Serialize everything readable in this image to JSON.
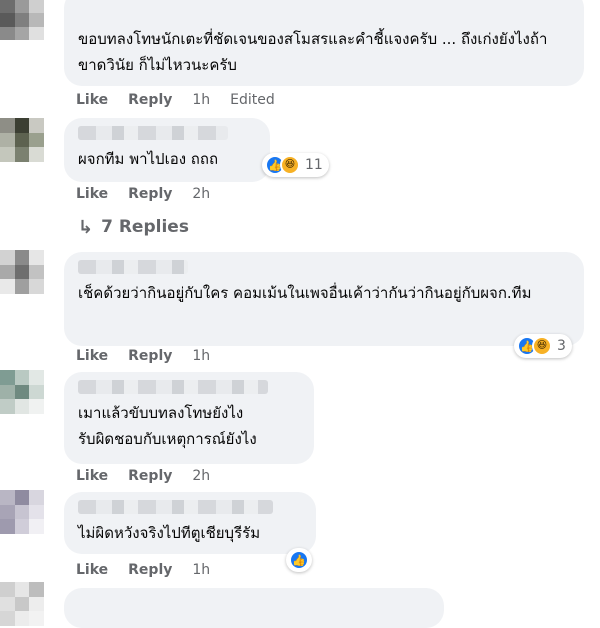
{
  "comments": [
    {
      "text": "ขอบทลงโทษนักเตะที่ชัดเจนของสโมสรและคำชี้แจงครับ ... ถึงเก่งยังไงถ้าขาดวินัย ก็ไม่ไหวนะครับ",
      "like": "Like",
      "reply": "Reply",
      "time": "1h",
      "edited": "Edited"
    },
    {
      "text": "ผจกทีม พาไปเอง ถถถ",
      "like": "Like",
      "reply": "Reply",
      "time": "2h",
      "reactions": {
        "count": "11",
        "icons": [
          "like-icon",
          "haha-icon"
        ]
      }
    },
    {
      "text": "เช็คด้วยว่ากินอยู่กับใคร คอมเม้นในเพจอื่นเค้าว่ากันว่ากินอยู่กับผจก.ทีม",
      "like": "Like",
      "reply": "Reply",
      "time": "1h",
      "reactions": {
        "count": "3",
        "icons": [
          "like-icon",
          "haha-icon"
        ]
      }
    },
    {
      "text": "เมาแล้วขับบทลงโทษยังไง\nรับผิดชอบกับเหตุการณ์ยังไง",
      "like": "Like",
      "reply": "Reply",
      "time": "2h"
    },
    {
      "text": "ไม่ผิดหวังจริงไปทีตูเชียบุรีรัม",
      "like": "Like",
      "reply": "Reply",
      "time": "1h",
      "reactions": {
        "icons": [
          "like-icon"
        ]
      }
    }
  ],
  "replies_link": "7 Replies",
  "colors": {
    "bubble": "#f0f2f5",
    "meta": "#65676b",
    "like": "#1877f2",
    "haha": "#f7b125"
  }
}
